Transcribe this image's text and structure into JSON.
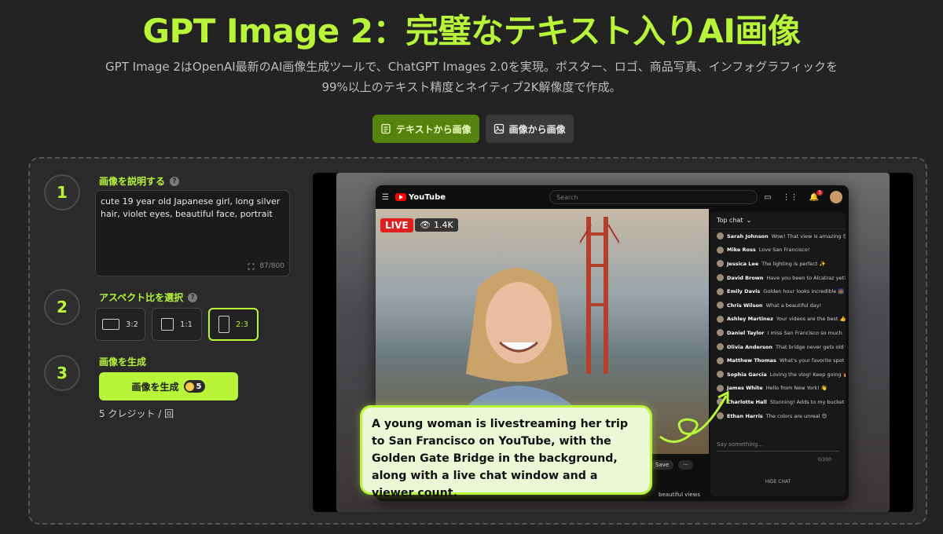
{
  "hero": {
    "title": "GPT Image 2：完璧なテキスト入りAI画像",
    "subtitle_line1": "GPT Image 2はOpenAI最新のAI画像生成ツールで、ChatGPT Images 2.0を実現。ポスター、ロゴ、商品写真、インフォグラフィックを",
    "subtitle_line2": "99%以上のテキスト精度とネイティブ2K解像度で作成。"
  },
  "mode_tabs": [
    {
      "label": "テキストから画像",
      "icon": "document-icon",
      "active": true
    },
    {
      "label": "画像から画像",
      "icon": "image-icon",
      "active": false
    }
  ],
  "steps": {
    "step1": {
      "number": "1",
      "label": "画像を説明する",
      "help": "?"
    },
    "step2": {
      "number": "2",
      "label": "アスペクト比を選択",
      "help": "?"
    },
    "step3": {
      "number": "3",
      "label": "画像を生成"
    }
  },
  "prompt": {
    "value": "cute 19 year old Japanese girl, long silver hair, violet eyes, beautiful face, portrait",
    "counter": "87/800"
  },
  "ratios": [
    {
      "label": "3:2",
      "active": false
    },
    {
      "label": "1:1",
      "active": false
    },
    {
      "label": "2:3",
      "active": true
    }
  ],
  "generate": {
    "label": "画像を生成",
    "credits": "5",
    "note": "5 クレジット / 回"
  },
  "preview": {
    "yt_logo": "YouTube",
    "search_placeholder": "Search",
    "notification_count": "3",
    "live": "LIVE",
    "viewers": "1.4K",
    "chat_title": "Top chat",
    "chat": [
      {
        "user": "Sarah Johnson",
        "text": "Wow! That view is amazing 😍"
      },
      {
        "user": "Mike Ross",
        "text": "Love San Francisco!"
      },
      {
        "user": "Jessica Lee",
        "text": "The lighting is perfect ✨"
      },
      {
        "user": "David Brown",
        "text": "Have you been to Alcatraz yet?"
      },
      {
        "user": "Emily Davis",
        "text": "Golden hour looks incredible 🌉"
      },
      {
        "user": "Chris Wilson",
        "text": "What a beautiful day!"
      },
      {
        "user": "Ashley Martinez",
        "text": "Your videos are the best 👍"
      },
      {
        "user": "Daniel Taylor",
        "text": "I miss San Francisco so much"
      },
      {
        "user": "Olivia Anderson",
        "text": "That bridge never gets old ❤️"
      },
      {
        "user": "Matthew Thomas",
        "text": "What's your favorite spot so far?"
      },
      {
        "user": "Sophia Garcia",
        "text": "Loving the vlog! Keep going 🔥"
      },
      {
        "user": "James White",
        "text": "Hello from New York! 👋"
      },
      {
        "user": "Charlotte Hall",
        "text": "Stunning! Adds to my bucket list"
      },
      {
        "user": "Ethan Harris",
        "text": "The colors are unreal 😍"
      }
    ],
    "chat_input": "Say something...",
    "chat_counter": "0/200",
    "hide_chat": "HIDE CHAT",
    "save": "Save",
    "more": "···",
    "snippet": "beautiful views",
    "callout": "A young woman is livestreaming her trip to San Francisco on YouTube, with the Golden Gate Bridge in the background, along with a live chat window and a viewer count."
  },
  "colors": {
    "accent": "#b8f53a",
    "background": "#232323",
    "live_red": "#e02020"
  }
}
